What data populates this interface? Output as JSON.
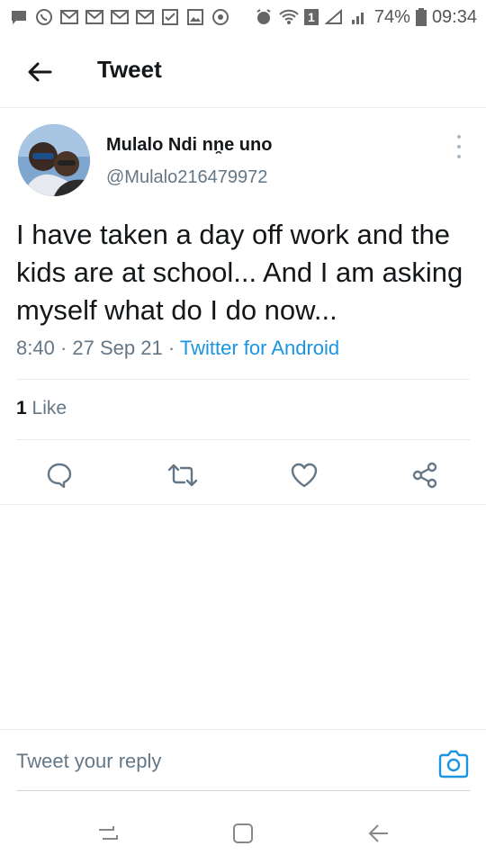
{
  "status_bar": {
    "battery_percent": "74%",
    "time": "09:34",
    "left_icons": [
      "message-icon",
      "whatsapp-icon",
      "gmail-icon",
      "gmail-icon",
      "gmail-icon",
      "gmail-icon",
      "task-check-icon",
      "gallery-icon",
      "sync-icon"
    ],
    "right_icons": [
      "alarm-icon",
      "wifi-icon",
      "sim-icon",
      "signal-icon",
      "signal-icon",
      "battery-icon"
    ],
    "sim_label": "1"
  },
  "header": {
    "title": "Tweet"
  },
  "tweet": {
    "author": {
      "display_name": "Mulalo Ndi nn̯e uno",
      "handle": "@Mulalo216479972"
    },
    "text": "I have taken a day off work and the kids are at school... And I am asking myself what do I do now...",
    "time": "8:40",
    "separator": " · ",
    "date": "27 Sep 21",
    "source": "Twitter for Android",
    "likes": {
      "count": "1",
      "label": "Like"
    }
  },
  "reply": {
    "placeholder": "Tweet your reply"
  },
  "colors": {
    "accent": "#1b95e0",
    "text_primary": "#14171a",
    "text_secondary": "#657786",
    "divider": "#e6ecf0"
  }
}
